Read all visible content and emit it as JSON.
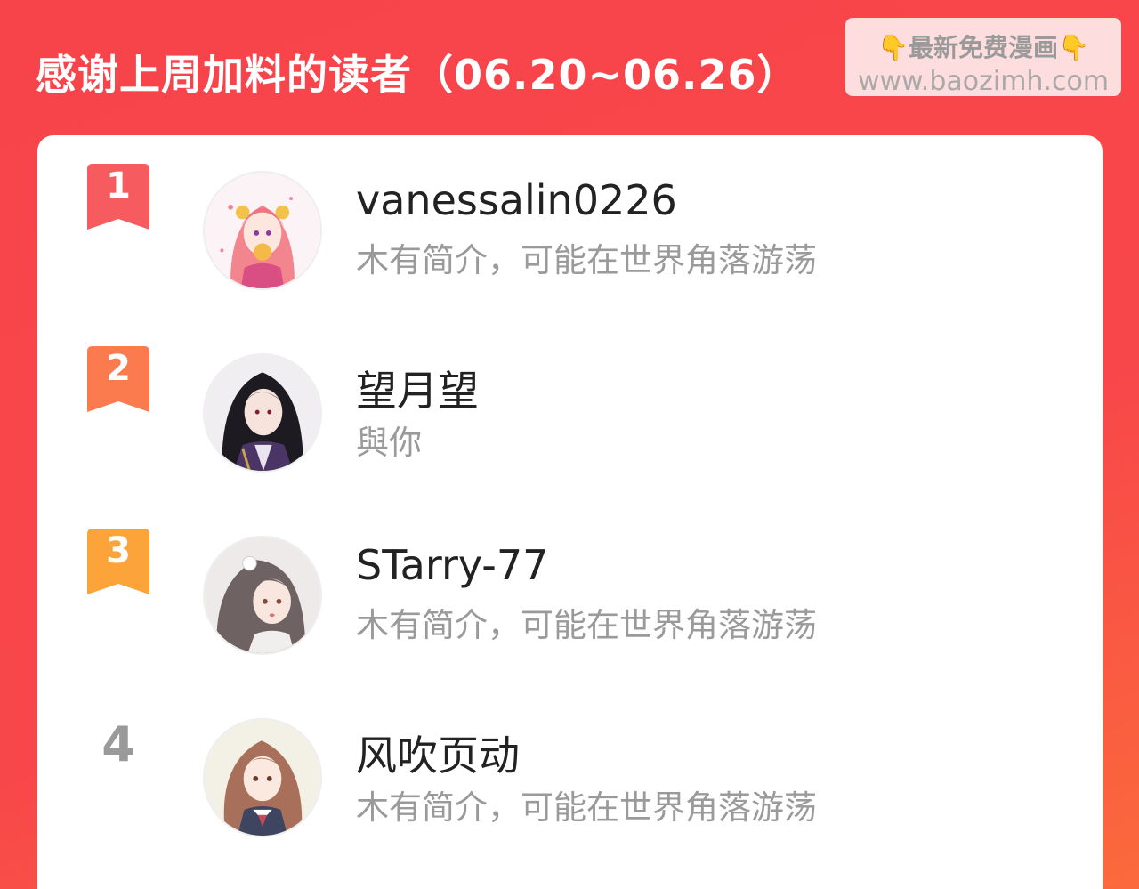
{
  "header": {
    "title": "感谢上周加料的读者（06.20~06.26）"
  },
  "watermark": {
    "line1": "最新免费漫画",
    "line2": "www.baozimh.com",
    "icon": "pointing-down-hand-icon"
  },
  "colors": {
    "background": "#f7444b",
    "rank1": "#f65b5f",
    "rank2": "#fb7a4e",
    "rank3": "#fca43a",
    "muted": "#9a9a9a"
  },
  "readers": [
    {
      "rank": "1",
      "name": "vanessalin0226",
      "bio": "木有简介，可能在世界角落游荡"
    },
    {
      "rank": "2",
      "name": "望月望",
      "bio": "與你"
    },
    {
      "rank": "3",
      "name": "STarry-77",
      "bio": "木有简介，可能在世界角落游荡"
    },
    {
      "rank": "4",
      "name": "风吹页动",
      "bio": "木有简介，可能在世界角落游荡"
    }
  ]
}
